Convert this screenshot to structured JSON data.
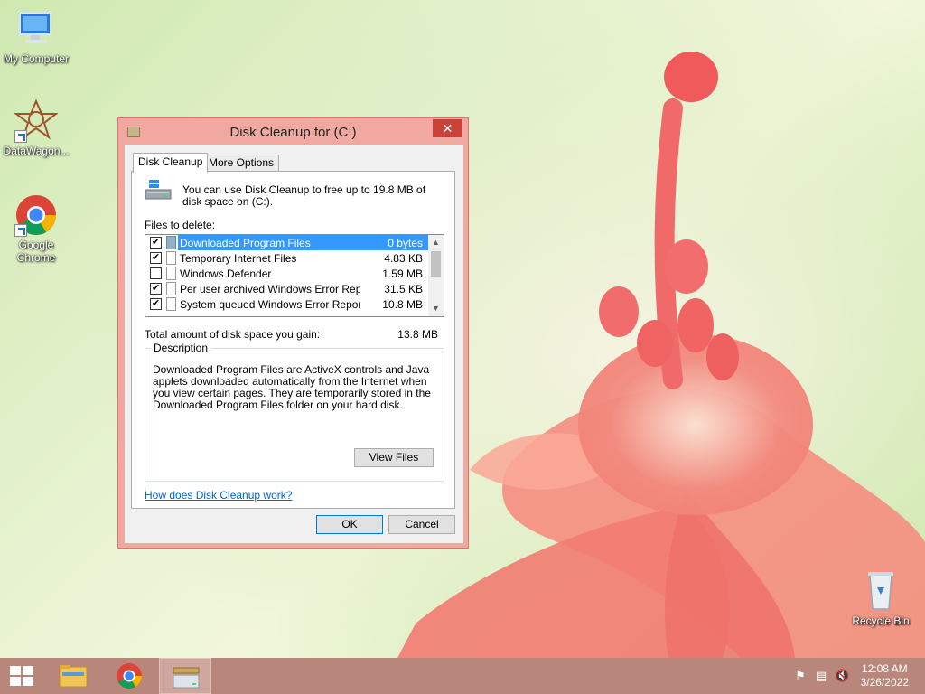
{
  "desktop": {
    "icons": [
      {
        "label": "My Computer"
      },
      {
        "label": "DataWagon..."
      },
      {
        "label": "Google Chrome"
      },
      {
        "label": "Recycle Bin"
      }
    ]
  },
  "window": {
    "title": "Disk Cleanup for  (C:)",
    "close_glyph": "✕",
    "tabs": [
      {
        "label": "Disk Cleanup",
        "active": true
      },
      {
        "label": "More Options",
        "active": false
      }
    ],
    "info_text": "You can use Disk Cleanup to free up to 19.8 MB of disk space on  (C:).",
    "files_label": "Files to delete:",
    "files": [
      {
        "name": "Downloaded Program Files",
        "size": "0 bytes",
        "checked": true,
        "selected": true
      },
      {
        "name": "Temporary Internet Files",
        "size": "4.83 KB",
        "checked": true,
        "selected": false
      },
      {
        "name": "Windows Defender",
        "size": "1.59 MB",
        "checked": false,
        "selected": false
      },
      {
        "name": "Per user archived Windows Error Repo...",
        "size": "31.5 KB",
        "checked": true,
        "selected": false
      },
      {
        "name": "System queued Windows Error Reporti...",
        "size": "10.8 MB",
        "checked": true,
        "selected": false
      }
    ],
    "total_label": "Total amount of disk space you gain:",
    "total_value": "13.8 MB",
    "description_legend": "Description",
    "description_text": "Downloaded Program Files are ActiveX controls and Java applets downloaded automatically from the Internet when you view certain pages. They are temporarily stored in the Downloaded Program Files folder on your hard disk.",
    "view_files_label": "View Files",
    "help_link": "How does Disk Cleanup work?",
    "ok_label": "OK",
    "cancel_label": "Cancel"
  },
  "taskbar": {
    "items": [
      {
        "icon": "windows-start-icon"
      },
      {
        "icon": "file-explorer-icon"
      },
      {
        "icon": "chrome-icon"
      },
      {
        "icon": "disk-cleanup-icon",
        "active": true
      }
    ],
    "tray_icons": [
      "action-center-flag-icon",
      "network-icon",
      "volume-muted-icon"
    ],
    "time": "12:08 AM",
    "date": "3/26/2022"
  },
  "colors": {
    "accent": "#3399ff",
    "window_frame": "#f0a8a0",
    "close_button": "#c9423a",
    "taskbar": "#b9867c"
  }
}
